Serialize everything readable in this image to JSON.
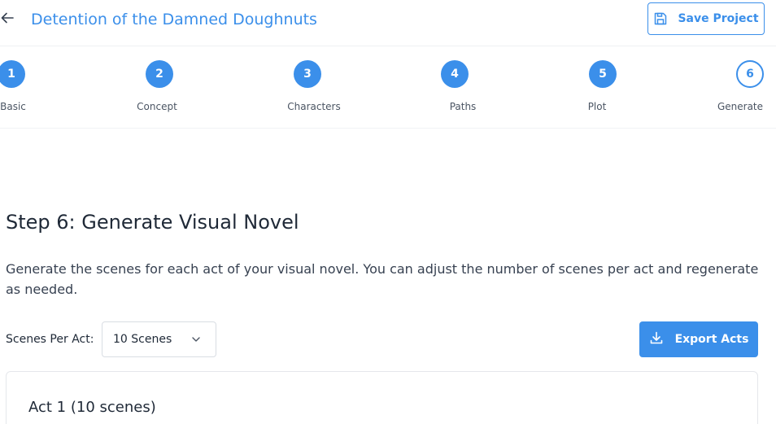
{
  "header": {
    "title": "Detention of the Damned Doughnuts",
    "save_label": "Save Project"
  },
  "stepper": {
    "steps": [
      {
        "number": "1",
        "label": "Basic",
        "state": "complete"
      },
      {
        "number": "2",
        "label": "Concept",
        "state": "complete"
      },
      {
        "number": "3",
        "label": "Characters",
        "state": "complete"
      },
      {
        "number": "4",
        "label": "Paths",
        "state": "complete"
      },
      {
        "number": "5",
        "label": "Plot",
        "state": "complete"
      },
      {
        "number": "6",
        "label": "Generate",
        "state": "current"
      }
    ]
  },
  "main": {
    "heading": "Step 6: Generate Visual Novel",
    "description": "Generate the scenes for each act of your visual novel. You can adjust the number of scenes per act and regenerate as needed.",
    "scenes_label": "Scenes Per Act:",
    "scenes_value": "10 Scenes",
    "export_label": "Export Acts",
    "acts": [
      {
        "title": "Act 1 (10 scenes)"
      }
    ]
  },
  "colors": {
    "accent": "#3b8fea",
    "text": "#1f2937",
    "border": "#e5e7eb"
  },
  "icons": {
    "back": "arrow-left-icon",
    "save": "floppy-disk-icon",
    "export": "download-icon",
    "select": "chevron-down-icon"
  }
}
